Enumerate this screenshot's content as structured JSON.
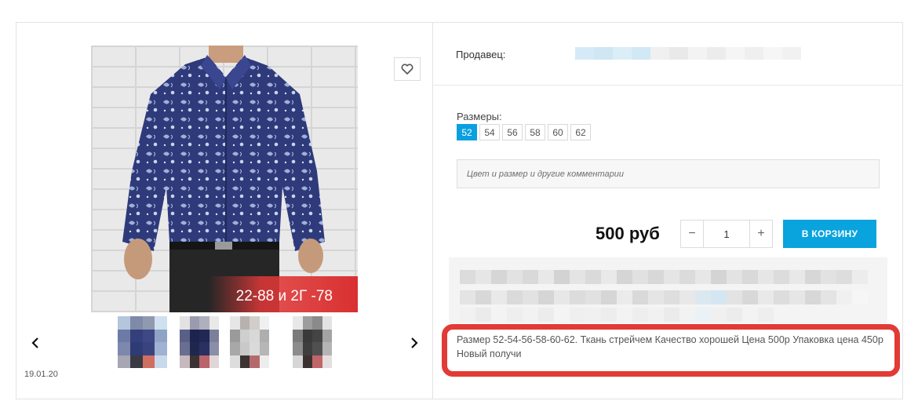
{
  "product": {
    "photo_caption": "22-88 и 2Г -78",
    "date": "19.01.20"
  },
  "seller": {
    "label": "Продавец:"
  },
  "sizes": {
    "label": "Размеры:",
    "options": [
      "52",
      "54",
      "56",
      "58",
      "60",
      "62"
    ],
    "selected": "52"
  },
  "comment": {
    "placeholder": "Цвет и размер и другие комментарии"
  },
  "purchase": {
    "price": "500 руб",
    "quantity": "1",
    "minus": "−",
    "plus": "+",
    "cart_label": "В КОРЗИНУ"
  },
  "description": {
    "text": "Размер 52-54-56-58-60-62. Ткань стрейчем Качество хорошей Цена 500р Упаковка цена 450р Новый получи"
  },
  "colors": {
    "accent": "#09a3de",
    "highlight_border": "#e23a35",
    "shirt": "#2e3a7a"
  },
  "icons": {
    "favorite": "heart-icon",
    "prev": "chevron-left-icon",
    "next": "chevron-right-icon"
  }
}
